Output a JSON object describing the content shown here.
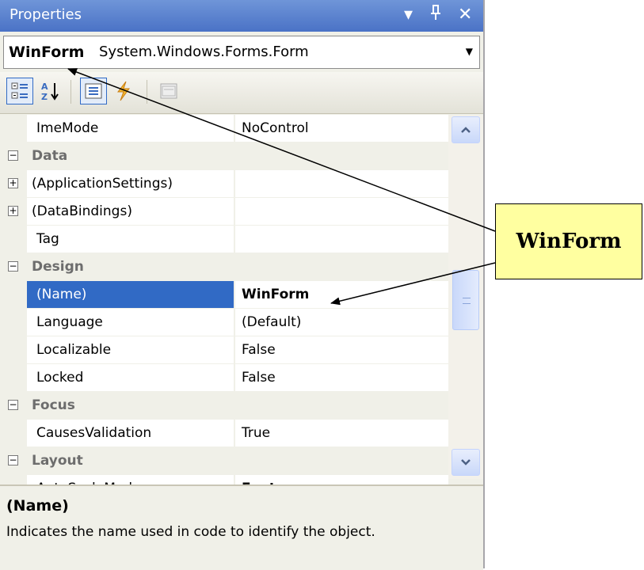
{
  "window": {
    "title": "Properties",
    "dropdown_glyph": "▾",
    "pin_glyph": "ᵖ",
    "close_glyph": "✕"
  },
  "object_selector": {
    "name": "WinForm",
    "type": "System.Windows.Forms.Form"
  },
  "toolbar": {
    "buttons": [
      "categorized-icon",
      "alphabetical-icon",
      "properties-icon",
      "events-icon",
      "property-pages-icon"
    ]
  },
  "grid": {
    "rows": [
      {
        "kind": "prop",
        "name": "ImeMode",
        "value": "NoControl"
      },
      {
        "kind": "cat",
        "name": "Data"
      },
      {
        "kind": "expandable",
        "name": "(ApplicationSettings)",
        "value": ""
      },
      {
        "kind": "expandable",
        "name": "(DataBindings)",
        "value": ""
      },
      {
        "kind": "prop",
        "name": "Tag",
        "value": ""
      },
      {
        "kind": "cat",
        "name": "Design"
      },
      {
        "kind": "prop",
        "name": "(Name)",
        "value": "WinForm",
        "selected": true,
        "bold": true
      },
      {
        "kind": "prop",
        "name": "Language",
        "value": "(Default)"
      },
      {
        "kind": "prop",
        "name": "Localizable",
        "value": "False"
      },
      {
        "kind": "prop",
        "name": "Locked",
        "value": "False"
      },
      {
        "kind": "cat",
        "name": "Focus"
      },
      {
        "kind": "prop",
        "name": "CausesValidation",
        "value": "True"
      },
      {
        "kind": "cat",
        "name": "Layout"
      },
      {
        "kind": "prop",
        "name": "AutoScaleMode",
        "value": "Font",
        "bold": true
      }
    ]
  },
  "description": {
    "title": "(Name)",
    "text": "Indicates the name used in code to identify the object."
  },
  "callout": {
    "text": "WinForm"
  },
  "colors": {
    "title_bar": "#5a80cc",
    "selection": "#316ac5",
    "callout_fill": "#ffffa0"
  }
}
